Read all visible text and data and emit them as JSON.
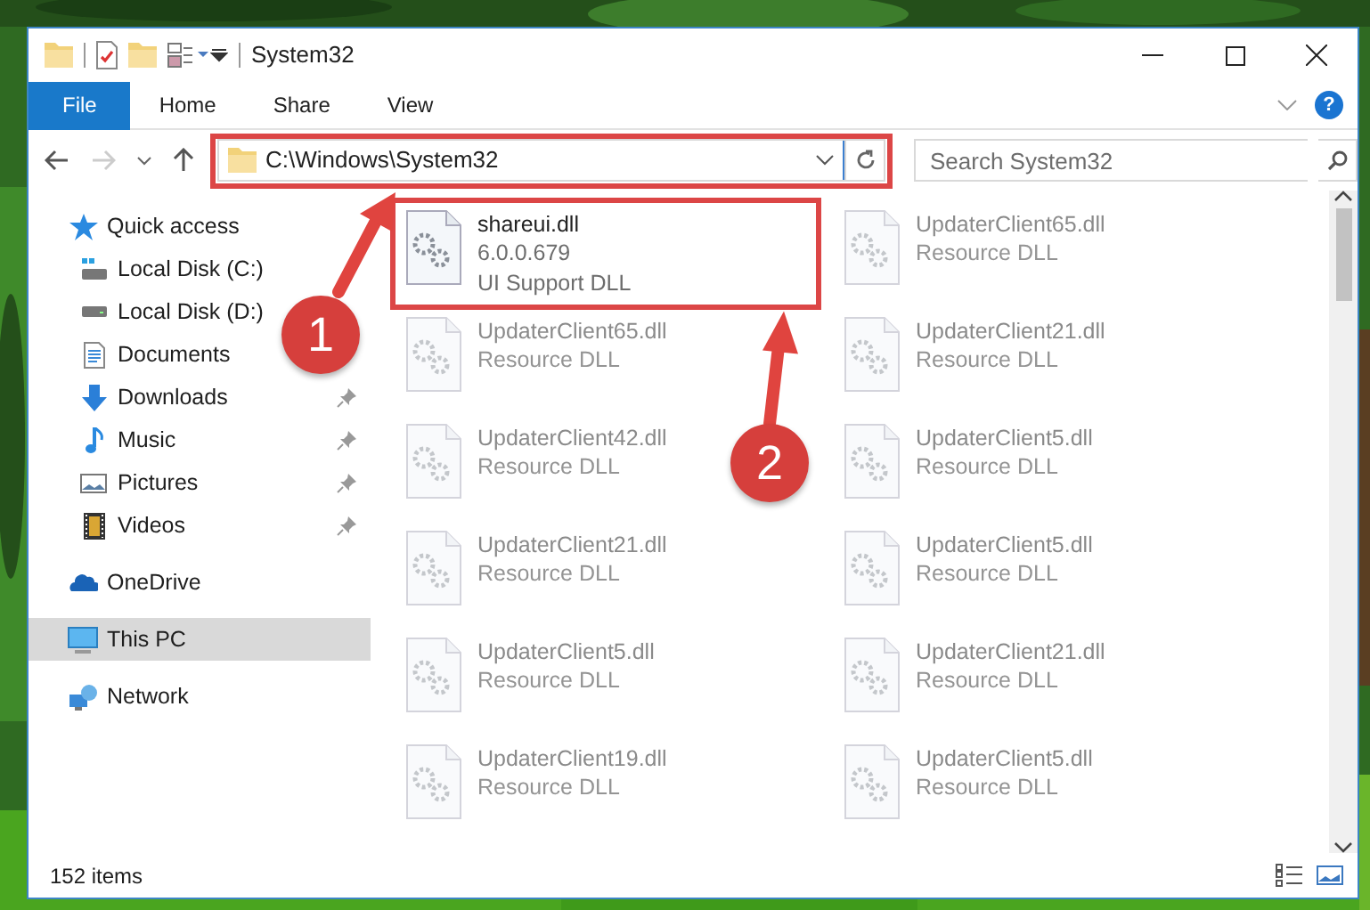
{
  "window": {
    "title": "System32"
  },
  "ribbon": {
    "tabs": [
      {
        "label": "File",
        "kind": "file"
      },
      {
        "label": "Home",
        "kind": "tab"
      },
      {
        "label": "Share",
        "kind": "tab"
      },
      {
        "label": "View",
        "kind": "tab"
      }
    ],
    "help_button": "?"
  },
  "address_bar": {
    "path": "C:\\Windows\\System32"
  },
  "search": {
    "placeholder": "Search System32"
  },
  "nav": [
    {
      "label": "Quick access",
      "selected": false,
      "children": [
        {
          "label": "Local Disk (C:)"
        },
        {
          "label": "Local Disk (D:)"
        },
        {
          "label": "Documents"
        },
        {
          "label": "Downloads",
          "pinned": true
        },
        {
          "label": "Music",
          "pinned": true
        },
        {
          "label": "Pictures",
          "pinned": true
        },
        {
          "label": "Videos",
          "pinned": true
        }
      ]
    },
    {
      "label": "OneDrive",
      "selected": false
    },
    {
      "label": "This PC",
      "selected": true
    },
    {
      "label": "Network",
      "selected": false
    }
  ],
  "files": [
    {
      "name": "shareui.dll",
      "version": "6.0.0.679",
      "description": "UI Support DLL",
      "dimmed": false
    },
    {
      "name": "UpdaterClient65.dll",
      "description": "Resource DLL",
      "dimmed": true
    },
    {
      "name": "UpdaterClient65.dll",
      "description": "Resource DLL",
      "dimmed": true
    },
    {
      "name": "UpdaterClient21.dll",
      "description": "Resource DLL",
      "dimmed": true
    },
    {
      "name": "UpdaterClient42.dll",
      "description": "Resource DLL",
      "dimmed": true
    },
    {
      "name": "UpdaterClient5.dll",
      "description": "Resource DLL",
      "dimmed": true
    },
    {
      "name": "UpdaterClient21.dll",
      "description": "Resource DLL",
      "dimmed": true
    },
    {
      "name": "UpdaterClient5.dll",
      "description": "Resource DLL",
      "dimmed": true
    },
    {
      "name": "UpdaterClient5.dll",
      "description": "Resource DLL",
      "dimmed": true
    },
    {
      "name": "UpdaterClient21.dll",
      "description": "Resource DLL",
      "dimmed": true
    },
    {
      "name": "UpdaterClient19.dll",
      "description": "Resource DLL",
      "dimmed": true
    },
    {
      "name": "UpdaterClient5.dll",
      "description": "Resource DLL",
      "dimmed": true
    }
  ],
  "status_bar": {
    "item_count": "152 items"
  },
  "annotations": [
    {
      "number": "1"
    },
    {
      "number": "2"
    }
  ]
}
